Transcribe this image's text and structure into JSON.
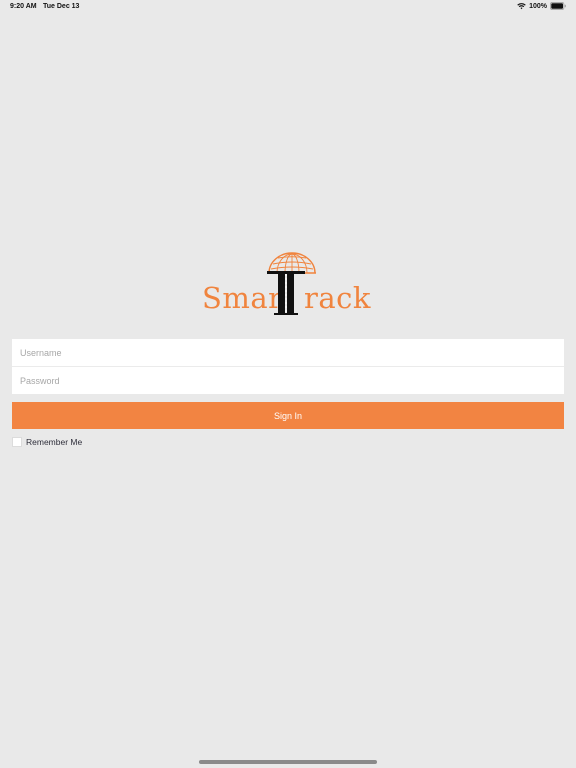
{
  "status_bar": {
    "time": "9:20 AM",
    "date": "Tue Dec 13",
    "battery": "100%",
    "wifi_icon": "wifi-icon",
    "battery_icon": "battery-icon"
  },
  "logo": {
    "text_part_1": "Smar",
    "text_part_2": "rack",
    "logo_letters": "TT",
    "brand_color": "#f0843e",
    "accent_color": "#111111"
  },
  "login": {
    "username_placeholder": "Username",
    "username_value": "",
    "password_placeholder": "Password",
    "password_value": "",
    "sign_in_label": "Sign In",
    "remember_label": "Remember Me",
    "remember_checked": false
  },
  "colors": {
    "background": "#e9e9e9",
    "button": "#f28442",
    "button_text": "#ffffff"
  }
}
